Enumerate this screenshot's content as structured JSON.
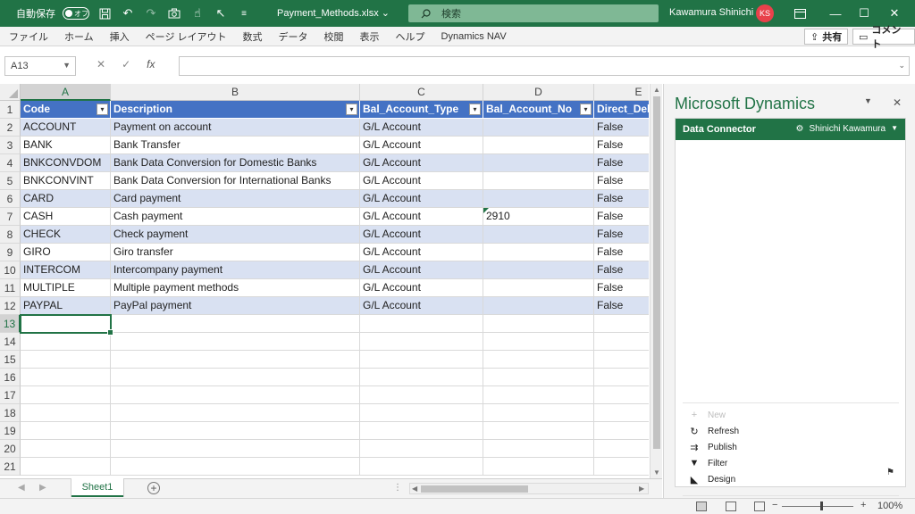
{
  "titlebar": {
    "autosave_label": "自動保存",
    "autosave_state": "オフ",
    "filename": "Payment_Methods.xlsx",
    "search_placeholder": "検索",
    "user_name": "Kawamura Shinichi",
    "avatar_initials": "KS"
  },
  "menu": {
    "items": [
      "ファイル",
      "ホーム",
      "挿入",
      "ページ レイアウト",
      "数式",
      "データ",
      "校閲",
      "表示",
      "ヘルプ",
      "Dynamics NAV"
    ],
    "share_label": "共有",
    "comment_label": "コメント"
  },
  "formula_bar": {
    "name_box": "A13",
    "formula": ""
  },
  "sheet": {
    "columns": [
      "A",
      "B",
      "C",
      "D",
      "E"
    ],
    "row_numbers": [
      "1",
      "2",
      "3",
      "4",
      "5",
      "6",
      "7",
      "8",
      "9",
      "10",
      "11",
      "12",
      "13",
      "14",
      "15",
      "16",
      "17",
      "18",
      "19",
      "20",
      "21"
    ],
    "headers": [
      "Code",
      "Description",
      "Bal_Account_Type",
      "Bal_Account_No",
      "Direct_Debit"
    ],
    "rows": [
      [
        "ACCOUNT",
        "Payment on account",
        "G/L Account",
        "",
        "False"
      ],
      [
        "BANK",
        "Bank Transfer",
        "G/L Account",
        "",
        "False"
      ],
      [
        "BNKCONVDOM",
        "Bank Data Conversion for Domestic Banks",
        "G/L Account",
        "",
        "False"
      ],
      [
        "BNKCONVINT",
        "Bank Data Conversion for International Banks",
        "G/L Account",
        "",
        "False"
      ],
      [
        "CARD",
        "Card payment",
        "G/L Account",
        "",
        "False"
      ],
      [
        "CASH",
        "Cash payment",
        "G/L Account",
        "2910",
        "False"
      ],
      [
        "CHECK",
        "Check payment",
        "G/L Account",
        "",
        "False"
      ],
      [
        "GIRO",
        "Giro transfer",
        "G/L Account",
        "",
        "False"
      ],
      [
        "INTERCOM",
        "Intercompany payment",
        "G/L Account",
        "",
        "False"
      ],
      [
        "MULTIPLE",
        "Multiple payment methods",
        "G/L Account",
        "",
        "False"
      ],
      [
        "PAYPAL",
        "PayPal payment",
        "G/L Account",
        "",
        "False"
      ]
    ],
    "tab_name": "Sheet1"
  },
  "statusbar": {
    "zoom": "100%"
  },
  "pane": {
    "title": "Microsoft Dynamics",
    "connector_title": "Data Connector",
    "connector_user": "Shinichi Kawamura",
    "actions": [
      "New",
      "Refresh",
      "Publish",
      "Filter",
      "Design"
    ]
  },
  "colors": {
    "excel_green": "#217346",
    "table_header": "#4472c4",
    "band": "#d9e1f2"
  }
}
